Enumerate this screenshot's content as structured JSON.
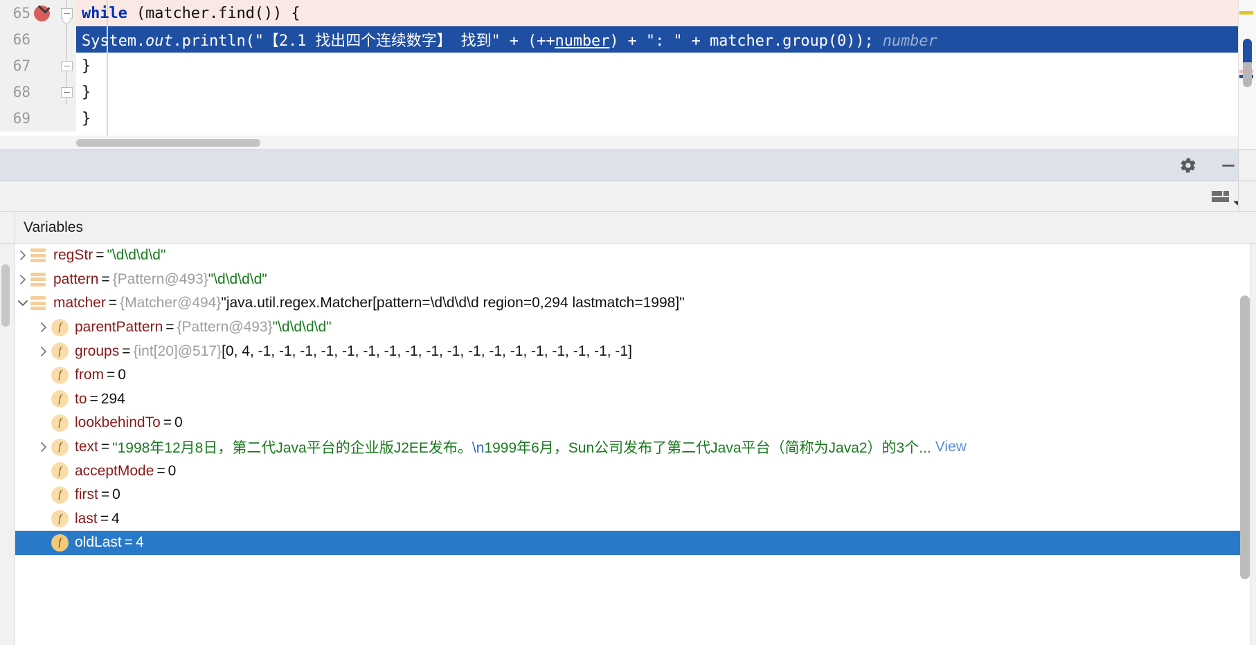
{
  "editor": {
    "lines": [
      {
        "number": "65",
        "indent": 0,
        "state": "executing",
        "has_breakpoint": true,
        "fold": "start",
        "tokens": [
          {
            "t": "        ",
            "c": "plain"
          },
          {
            "t": "while",
            "c": "keyword"
          },
          {
            "t": " (matcher.find()) {",
            "c": "plain"
          }
        ],
        "plain": "        while (matcher.find()) {"
      },
      {
        "number": "66",
        "indent": 0,
        "state": "caret",
        "has_breakpoint": false,
        "fold": "none",
        "tokens": [
          {
            "t": "            System.",
            "c": "plain"
          },
          {
            "t": "out",
            "c": "italic"
          },
          {
            "t": ".println(\"【2.1 找出四个连续数字】 找到\" + (++",
            "c": "plain"
          },
          {
            "t": "number",
            "c": "underline"
          },
          {
            "t": ") + \": \" + matcher.group(0));",
            "c": "plain"
          }
        ],
        "plain": "            System.out.println(\"【2.1 找出四个连续数字】 找到\" + (++number) + \": \" + matcher.group(0));",
        "inlay_hint": "number"
      },
      {
        "number": "67",
        "indent": 0,
        "state": "normal",
        "has_breakpoint": false,
        "fold": "end",
        "tokens": [
          {
            "t": "        }",
            "c": "plain"
          }
        ],
        "plain": "        }"
      },
      {
        "number": "68",
        "indent": 0,
        "state": "normal",
        "has_breakpoint": false,
        "fold": "end",
        "tokens": [
          {
            "t": "    }",
            "c": "plain"
          }
        ],
        "plain": "    }"
      },
      {
        "number": "69",
        "indent": 0,
        "state": "normal",
        "has_breakpoint": false,
        "fold": "none",
        "tokens": [
          {
            "t": "}",
            "c": "plain"
          }
        ],
        "plain": "}"
      }
    ],
    "breakpoint_icon": "breakpoint-verified-icon",
    "scrollbar": {
      "horizontal_icon": "horizontal-scrollbar",
      "vertical_icon": "vertical-scrollbar"
    },
    "markers": [
      {
        "name": "warning-marker",
        "color": "#e8c51e"
      },
      {
        "name": "error-marker",
        "color": "#f0b8b8"
      },
      {
        "name": "caret-marker",
        "color": "#1f4fa3"
      }
    ]
  },
  "debug_toolbar": {
    "buttons": [
      {
        "name": "settings-button",
        "icon": "gear-icon",
        "label": "Settings"
      },
      {
        "name": "minimize-button",
        "icon": "minimize-icon",
        "label": "Hide"
      }
    ],
    "background": "#dde1ea"
  },
  "debug_subbar": {
    "buttons": [
      {
        "name": "layout-settings-button",
        "icon": "layout-grid-icon",
        "label": "Layout Settings"
      },
      {
        "name": "layout-dropdown-button",
        "icon": "chevron-down-icon",
        "label": "More"
      }
    ]
  },
  "variables_panel": {
    "title": "Variables",
    "selected_row_color": "#2979c9",
    "rows": [
      {
        "depth": 0,
        "expander": "collapsed",
        "icon": "local-variable-icon",
        "name": "regStr",
        "eq": "=",
        "ref": "",
        "value": "\"\\d\\d\\d\\d\"",
        "value_kind": "string",
        "selected": false
      },
      {
        "depth": 0,
        "expander": "collapsed",
        "icon": "local-variable-icon",
        "name": "pattern",
        "eq": "=",
        "ref": "{Pattern@493}",
        "value": "\"\\d\\d\\d\\d\"",
        "value_kind": "string",
        "selected": false
      },
      {
        "depth": 0,
        "expander": "expanded",
        "icon": "local-variable-icon",
        "name": "matcher",
        "eq": "=",
        "ref": "{Matcher@494}",
        "value": "\"java.util.regex.Matcher[pattern=\\d\\d\\d\\d region=0,294 lastmatch=1998]\"",
        "value_kind": "plain",
        "selected": false
      },
      {
        "depth": 1,
        "expander": "collapsed",
        "icon": "field-icon",
        "name": "parentPattern",
        "eq": "=",
        "ref": "{Pattern@493}",
        "value": "\"\\d\\d\\d\\d\"",
        "value_kind": "string",
        "selected": false
      },
      {
        "depth": 1,
        "expander": "collapsed",
        "icon": "field-icon",
        "name": "groups",
        "eq": "=",
        "ref": "{int[20]@517}",
        "value": "[0, 4, -1, -1, -1, -1, -1, -1, -1, -1, -1, -1, -1, -1, -1, -1, -1, -1, -1, -1]",
        "value_kind": "plain",
        "selected": false
      },
      {
        "depth": 1,
        "expander": "none",
        "icon": "field-icon",
        "name": "from",
        "eq": "=",
        "ref": "",
        "value": "0",
        "value_kind": "number",
        "selected": false
      },
      {
        "depth": 1,
        "expander": "none",
        "icon": "field-icon",
        "name": "to",
        "eq": "=",
        "ref": "",
        "value": "294",
        "value_kind": "number",
        "selected": false
      },
      {
        "depth": 1,
        "expander": "none",
        "icon": "field-icon",
        "name": "lookbehindTo",
        "eq": "=",
        "ref": "",
        "value": "0",
        "value_kind": "number",
        "selected": false
      },
      {
        "depth": 1,
        "expander": "collapsed",
        "icon": "field-icon",
        "name": "text",
        "eq": "=",
        "ref": "",
        "value_parts": [
          {
            "t": "\"1998年12月8日，第二代Java平台的企业版J2EE发布。",
            "c": "string"
          },
          {
            "t": "\\n",
            "c": "escape"
          },
          {
            "t": "1999年6月，Sun公司发布了第二代Java平台（简称为Java2）的3个...",
            "c": "string"
          }
        ],
        "value": "\"1998年12月8日，第二代Java平台的企业版J2EE发布。\\n1999年6月，Sun公司发布了第二代Java平台（简称为Java2）的3个...",
        "value_kind": "multipart",
        "link": "View",
        "selected": false
      },
      {
        "depth": 1,
        "expander": "none",
        "icon": "field-icon",
        "name": "acceptMode",
        "eq": "=",
        "ref": "",
        "value": "0",
        "value_kind": "number",
        "selected": false
      },
      {
        "depth": 1,
        "expander": "none",
        "icon": "field-icon",
        "name": "first",
        "eq": "=",
        "ref": "",
        "value": "0",
        "value_kind": "number",
        "selected": false
      },
      {
        "depth": 1,
        "expander": "none",
        "icon": "field-icon",
        "name": "last",
        "eq": "=",
        "ref": "",
        "value": "4",
        "value_kind": "number",
        "selected": false
      },
      {
        "depth": 1,
        "expander": "none",
        "icon": "field-icon",
        "name": "oldLast",
        "eq": "=",
        "ref": "",
        "value": "4",
        "value_kind": "number",
        "selected": true
      }
    ]
  }
}
